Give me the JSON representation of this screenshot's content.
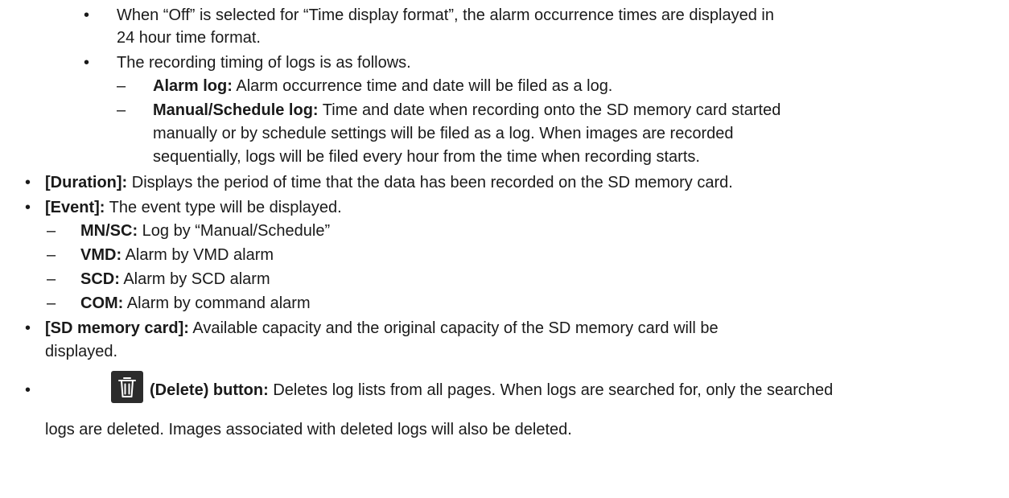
{
  "nested": [
    {
      "text_line1": "When “Off” is selected for “Time display format”, the alarm occurrence times are displayed in",
      "text_line2": "24 hour time format."
    },
    {
      "text_line1": "The recording timing of logs is as follows.",
      "subitems": [
        {
          "label": "Alarm log:",
          "text_line1": " Alarm occurrence time and date will be filed as a log."
        },
        {
          "label": "Manual/Schedule log:",
          "text_line1": " Time and date when recording onto the SD memory card started",
          "text_line2": "manually or by schedule settings will be filed as a log. When images are recorded",
          "text_line3": "sequentially, logs will be filed every hour from the time when recording starts."
        }
      ]
    }
  ],
  "items": [
    {
      "label": "[Duration]:",
      "text_line1": " Displays the period of time that the data has been recorded on the SD memory card."
    },
    {
      "label": "[Event]:",
      "text_line1": " The event type will be displayed.",
      "subitems": [
        {
          "label": "MN/SC:",
          "text": " Log by “Manual/Schedule”"
        },
        {
          "label": "VMD:",
          "text": " Alarm by VMD alarm"
        },
        {
          "label": "SCD:",
          "text": " Alarm by SCD alarm"
        },
        {
          "label": "COM:",
          "text": " Alarm by command alarm"
        }
      ]
    },
    {
      "label": "[SD memory card]:",
      "text_line1": " Available capacity and the original capacity of the SD memory card will be",
      "text_line2": "displayed."
    },
    {
      "icon": "trash-icon",
      "label": "(Delete) button:",
      "text_line1": " Deletes log lists from all pages. When logs are searched for, only the searched",
      "text_line2": "logs are deleted. Images associated with deleted logs will also be deleted."
    }
  ],
  "glyphs": {
    "bullet": "•",
    "dash": "–"
  }
}
